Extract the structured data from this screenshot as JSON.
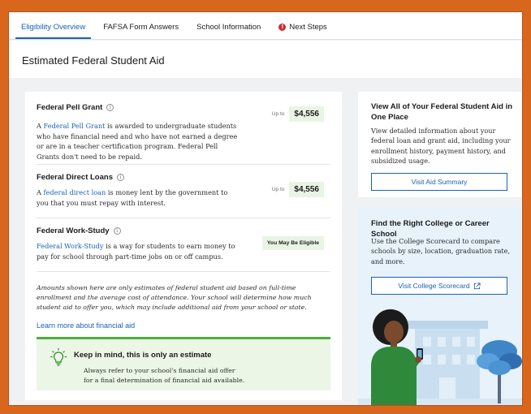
{
  "tabs": [
    {
      "label": "Eligibility Overview",
      "active": true
    },
    {
      "label": "FAFSA Form Answers",
      "active": false
    },
    {
      "label": "School Information",
      "active": false
    },
    {
      "label": "Next Steps",
      "active": false,
      "alert": true
    }
  ],
  "page_title": "Estimated Federal Student Aid",
  "aid": {
    "pell": {
      "title": "Federal Pell Grant",
      "desc_prefix": "A ",
      "link": "Federal Pell Grant",
      "desc_suffix": " is awarded to undergraduate students who have financial need and who have not earned a degree or are in a teacher certification program. Federal Pell Grants don't need to be repaid.",
      "upto": "Up to",
      "amount": "$4,556"
    },
    "direct": {
      "title": "Federal Direct Loans",
      "desc_prefix": "A ",
      "link": "federal direct loan",
      "desc_suffix": " is money lent by the government to you that you must repay with interest.",
      "upto": "Up to",
      "amount": "$4,556"
    },
    "workstudy": {
      "title": "Federal Work-Study",
      "desc_prefix": "",
      "link": "Federal Work-Study",
      "desc_suffix": " is a way for students to earn money to pay for school through part-time jobs on or off campus.",
      "badge": "You May Be Eligible"
    }
  },
  "disclaimer": "Amounts shown here are only estimates of federal student aid based on full-time enrollment and the average cost of attendance. Your school will determine how much student aid to offer you, which may include additional aid from your school or state.",
  "learn_more": "Learn more about financial aid",
  "estimate_box": {
    "title": "Keep in mind, this is only an estimate",
    "text": "Always refer to your school's financial aid offer for a final determination of financial aid available."
  },
  "summary_card": {
    "title": "View All of Your Federal Student Aid in One Place",
    "desc": "View detailed information about your federal loan and grant aid, including your enrollment history, payment history, and subsidized usage.",
    "button": "Visit Aid Summary"
  },
  "scorecard_card": {
    "title": "Find the Right College or Career School",
    "desc": "Use the College Scorecard to compare schools by size, location, graduation rate, and more.",
    "button": "Visit College Scorecard"
  },
  "colors": {
    "accent": "#1a62b8",
    "frame": "#d8661c",
    "success": "#4caf3c",
    "alert": "#d42b2b"
  },
  "icons": [
    "info-icon",
    "alert-icon",
    "lightbulb-icon",
    "external-link-icon"
  ]
}
